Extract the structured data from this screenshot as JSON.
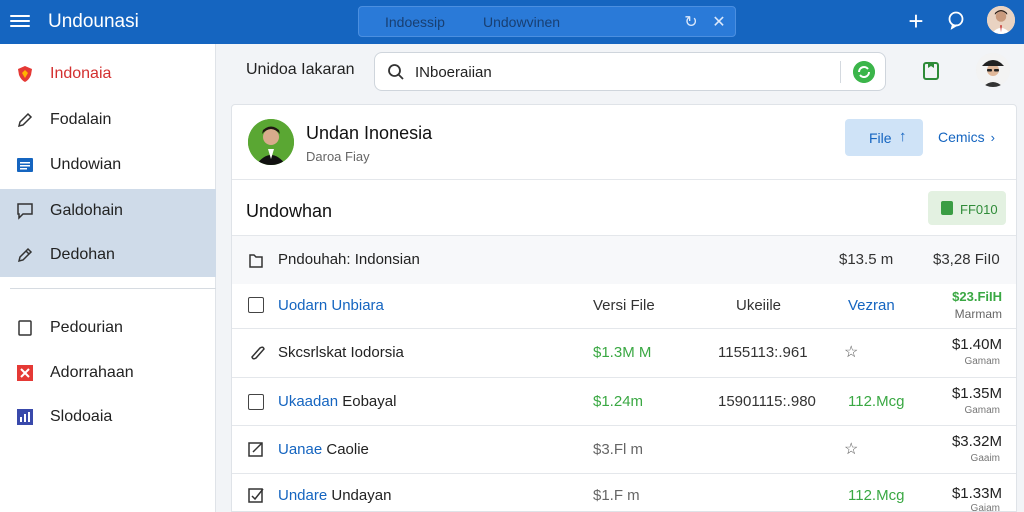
{
  "app": {
    "title": "Undounasi"
  },
  "top_search": {
    "tab_a": "Indoessip",
    "tab_b": "Undowvinen"
  },
  "sidebar": {
    "items": [
      {
        "label": "Indonaia",
        "icon": "shield-icon"
      },
      {
        "label": "Fodalain",
        "icon": "pen-icon"
      },
      {
        "label": "Undowian",
        "icon": "list-icon"
      },
      {
        "label": "Galdohain",
        "icon": "chat-icon"
      },
      {
        "label": "Dedohan",
        "icon": "pen-icon"
      },
      {
        "label": "Pedourian",
        "icon": "page-icon"
      },
      {
        "label": "Adorrahaan",
        "icon": "close-box-icon"
      },
      {
        "label": "Slodoaia",
        "icon": "chart-icon"
      }
    ]
  },
  "toolbar": {
    "crumb": "Unidoa Iakaran",
    "search_value": "INboeraiian"
  },
  "card": {
    "profile_name": "Undan Inonesia",
    "profile_sub": "Daroa Fiay",
    "file_label": "File",
    "comics_label": "Cemics",
    "section_title": "Undowhan",
    "free_label": "FF010"
  },
  "header_row": {
    "name": "Pndouhah: Indonsian",
    "col1": "$13.5 m",
    "col2": "$3,28 FiI0"
  },
  "columns": {
    "name": "Uodarn Unbiara",
    "c1": "Versi File",
    "c2": "Ukeiile",
    "c3": "Vezran",
    "c4": "$23.FiIH",
    "c4_sub": "Marmam"
  },
  "rows": [
    {
      "prefix": "",
      "name": "Skcsrlskat Iodorsia",
      "c1": "$1.3M M",
      "c2": "1155113:.961",
      "c3": "",
      "starred": true,
      "amt": "$1.40M",
      "amt_sub": "Gamam"
    },
    {
      "prefix": "Ukaadan",
      "name": "Eobayal",
      "c1": "$1.24m",
      "c2": "15901115:.980",
      "c3": "112.Mcg",
      "starred": false,
      "amt": "$1.35M",
      "amt_sub": "Gamam"
    },
    {
      "prefix": "Uanae",
      "name": "Caolie",
      "c1": "$3.Fl m",
      "c2": "",
      "c3": "",
      "starred": true,
      "amt": "$3.32M",
      "amt_sub": "Gaaim"
    },
    {
      "prefix": "Undare",
      "name": "Undayan",
      "c1": "$1.F m",
      "c2": "",
      "c3": "112.Mcg",
      "starred": false,
      "amt": "$1.33M",
      "amt_sub": "Gaiam"
    }
  ],
  "colors": {
    "primary": "#1565c0",
    "accent_green": "#3aa843",
    "sidebar_active": "#cfdbe9"
  }
}
